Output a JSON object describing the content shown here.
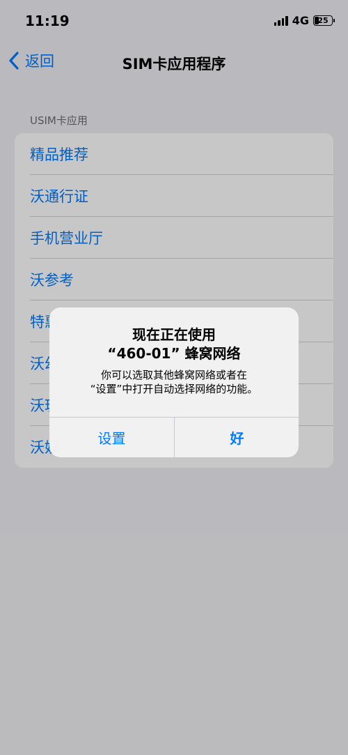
{
  "status_bar": {
    "time": "11:19",
    "network": "4G",
    "battery": "25"
  },
  "nav": {
    "back_label": "返回",
    "title": "SIM卡应用程序"
  },
  "section": {
    "header": "USIM卡应用",
    "items": [
      {
        "label": "精品推荐"
      },
      {
        "label": "沃通行证"
      },
      {
        "label": "手机营业厅"
      },
      {
        "label": "沃参考"
      },
      {
        "label": "特惠"
      },
      {
        "label": "沃幻"
      },
      {
        "label": "沃玩"
      },
      {
        "label": "沃娱"
      }
    ]
  },
  "alert": {
    "title_line1": "现在正在使用",
    "title_line2": "“460-01” 蜂窝网络",
    "message_line1": "你可以选取其他蜂窝网络或者在",
    "message_line2": "“设置”中打开自动选择网络的功能。",
    "button_settings": "设置",
    "button_ok": "好"
  },
  "colors": {
    "accent": "#007aff",
    "background": "#efeff4",
    "card": "#ffffff"
  }
}
